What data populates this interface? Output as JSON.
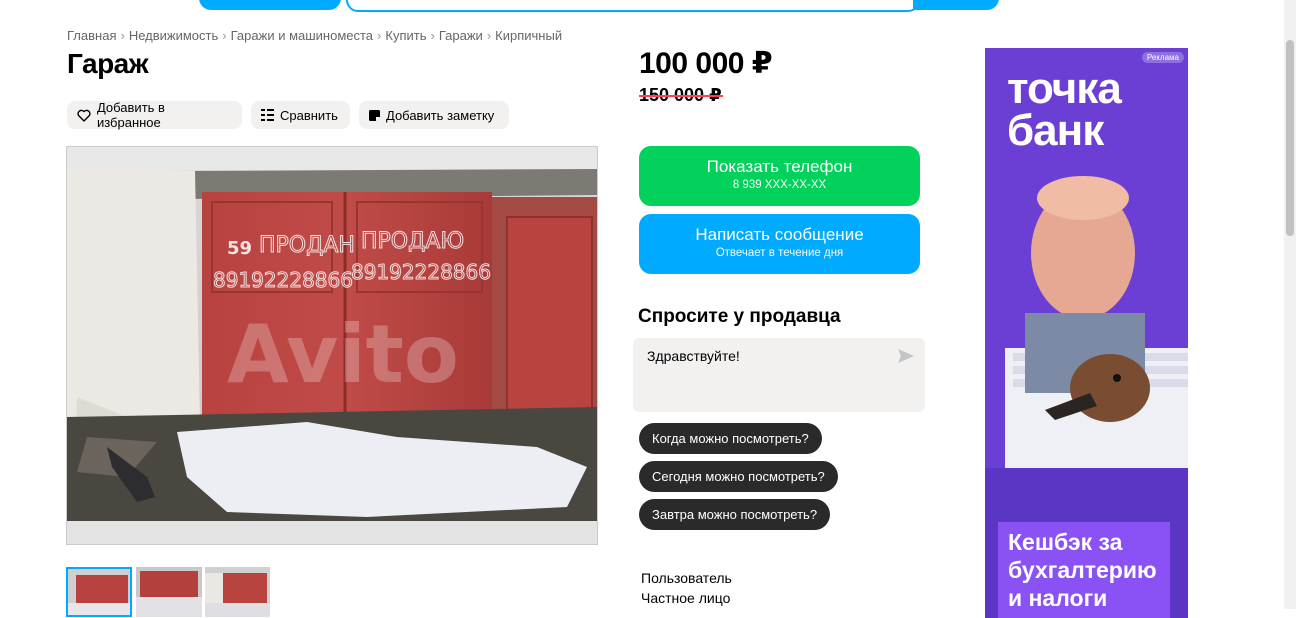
{
  "breadcrumb": [
    {
      "label": "Главная"
    },
    {
      "label": "Недвижимость"
    },
    {
      "label": "Гаражи и машиноместа"
    },
    {
      "label": "Купить"
    },
    {
      "label": "Гаражи"
    },
    {
      "label": "Кирпичный"
    }
  ],
  "listing": {
    "title": "Гараж",
    "price": "100 000 ₽",
    "old_price": "150 000 ₽",
    "photo_count": 3
  },
  "actions": {
    "favorite": "Добавить в избранное",
    "compare": "Сравнить",
    "note": "Добавить заметку"
  },
  "contact": {
    "phone_label": "Показать телефон",
    "phone_number": "8 939 XXX-XX-XX",
    "message_label": "Написать сообщение",
    "message_sub": "Отвечает в течение дня"
  },
  "ask": {
    "title": "Спросите у продавца",
    "message": "Здравствуйте!",
    "quick_questions": [
      "Когда можно посмотреть?",
      "Сегодня можно посмотреть?",
      "Завтра можно посмотреть?"
    ]
  },
  "seller": {
    "name": "Пользователь",
    "type": "Частное лицо"
  },
  "ad": {
    "tag": "Реклама",
    "brand_line1": "точка",
    "brand_line2": "банк",
    "bottom_line1": "Кешбэк за",
    "bottom_line2": "бухгалтерию",
    "bottom_line3": "и налоги"
  },
  "photo_text": {
    "number": "59",
    "word1": "ПРОДАН",
    "word2": "ПРОДАЮ",
    "phone1": "89192228866",
    "phone2": "89192228866",
    "watermark": "Avito"
  },
  "colors": {
    "green": "#02d15c",
    "blue": "#00aaff",
    "ad_purple": "#6b3fd4"
  }
}
